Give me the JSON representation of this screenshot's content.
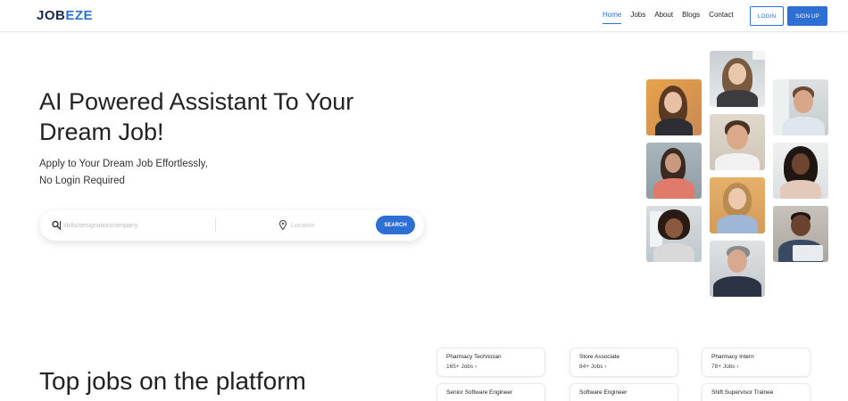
{
  "header": {
    "logo_part1": "JOB",
    "logo_part2": "EZE",
    "nav": [
      "Home",
      "Jobs",
      "About",
      "Blogs",
      "Contact"
    ],
    "active_nav": "Home",
    "login_label": "LOGIN",
    "signup_label": "SIGN UP"
  },
  "hero": {
    "title_line1": "AI Powered Assistant To Your",
    "title_line2": "Dream Job!",
    "subtitle_line1": "Apply to Your Dream Job Effortlessly,",
    "subtitle_line2": "No Login Required"
  },
  "search": {
    "job_placeholder": "skills/designation/company",
    "location_placeholder": "Location",
    "button_label": "SEARCH"
  },
  "top_jobs": {
    "title": "Top jobs on the platform",
    "cards": [
      {
        "title": "Pharmacy Technician",
        "count": "165+ Jobs"
      },
      {
        "title": "Store Associate",
        "count": "84+ Jobs"
      },
      {
        "title": "Pharmacy Intern",
        "count": "78+ Jobs"
      },
      {
        "title": "Senior Software Engineer",
        "count": ""
      },
      {
        "title": "Software Engineer",
        "count": ""
      },
      {
        "title": "Shift Supervisor Trainee",
        "count": ""
      }
    ]
  },
  "icons": {
    "search": "search-icon",
    "location": "location-pin-icon",
    "chevron": "chevron-right-icon"
  },
  "colors": {
    "brand_blue": "#2d6fd3",
    "logo_dark": "#1b2a4a"
  }
}
